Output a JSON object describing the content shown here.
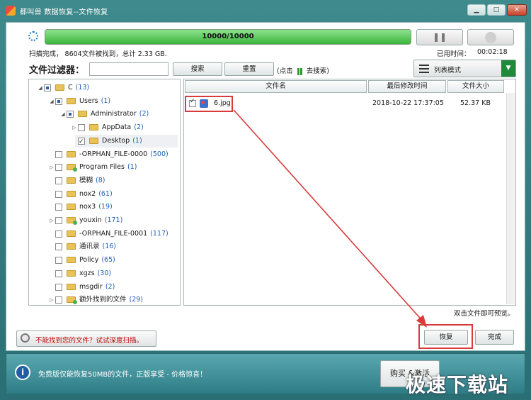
{
  "window": {
    "title": "都叫兽 数据恢复--文件恢复",
    "min": "▁",
    "max": "□",
    "close": "✕"
  },
  "scan": {
    "progress": "10000/10000",
    "progress_fraction": 1.0,
    "status": "扫描完成， 8604文件被找到，总计 2.33 GB.",
    "elapsed_label": "已用时间：",
    "elapsed": "00:02:18",
    "pause_icon": "❚❚"
  },
  "filter": {
    "label": "文件过滤器：",
    "search_value": "",
    "search_btn": "搜索",
    "reset_btn": "重置",
    "hint_prefix": "(点击",
    "hint_suffix": "去搜索)",
    "view_mode": "列表模式"
  },
  "tree": [
    {
      "arrow": "◢",
      "check": "part",
      "name": "C",
      "count": "(13)"
    },
    {
      "arrow": "◢",
      "check": "part",
      "name": "Users",
      "count": "(1)"
    },
    {
      "arrow": "◢",
      "check": "part",
      "name": "Administrator",
      "count": "(2)"
    },
    {
      "arrow": "▷",
      "check": "none",
      "name": "AppData",
      "count": "(2)"
    },
    {
      "arrow": "",
      "check": "chk",
      "name": "Desktop",
      "count": "(1)"
    },
    {
      "arrow": "",
      "check": "none",
      "name": "-ORPHAN_FILE-0000",
      "count": "(500)"
    },
    {
      "arrow": "▷",
      "check": "none",
      "name": "Program Files",
      "count": "(1)"
    },
    {
      "arrow": "",
      "check": "none",
      "name": "模糊",
      "count": "(8)"
    },
    {
      "arrow": "",
      "check": "none",
      "name": "nox2",
      "count": "(61)"
    },
    {
      "arrow": "",
      "check": "none",
      "name": "nox3",
      "count": "(19)"
    },
    {
      "arrow": "▷",
      "check": "none",
      "name": "youxin",
      "count": "(171)"
    },
    {
      "arrow": "",
      "check": "none",
      "name": "-ORPHAN_FILE-0001",
      "count": "(117)"
    },
    {
      "arrow": "",
      "check": "none",
      "name": "通讯录",
      "count": "(16)"
    },
    {
      "arrow": "",
      "check": "none",
      "name": "Policy",
      "count": "(65)"
    },
    {
      "arrow": "",
      "check": "none",
      "name": "xgzs",
      "count": "(30)"
    },
    {
      "arrow": "",
      "check": "none",
      "name": "msgdir",
      "count": "(2)"
    },
    {
      "arrow": "▷",
      "check": "none",
      "name": "额外找到的文件",
      "count": "(29)"
    }
  ],
  "list": {
    "columns": [
      "文件名",
      "最后修改时间",
      "文件大小"
    ],
    "rows": [
      {
        "name": "6.jpg",
        "modified": "2018-10-22 17:37:05",
        "size": "52.37 KB",
        "checked": true
      }
    ],
    "hint": "双击文件即可预览。"
  },
  "deep_scan": "不能找到您的文件？试试深度扫描。",
  "recover_btn": "恢复",
  "finish_btn": "完成",
  "footer": {
    "notice": "免费版仅能恢复50MB的文件，正版享受 - 价格惊喜！",
    "buy_btn": "购买 &激活",
    "watermark": "极速下载站"
  },
  "colors": {
    "accent": "#2e7d86",
    "progress": "#3cb53c",
    "highlight": "#d93a3a"
  }
}
